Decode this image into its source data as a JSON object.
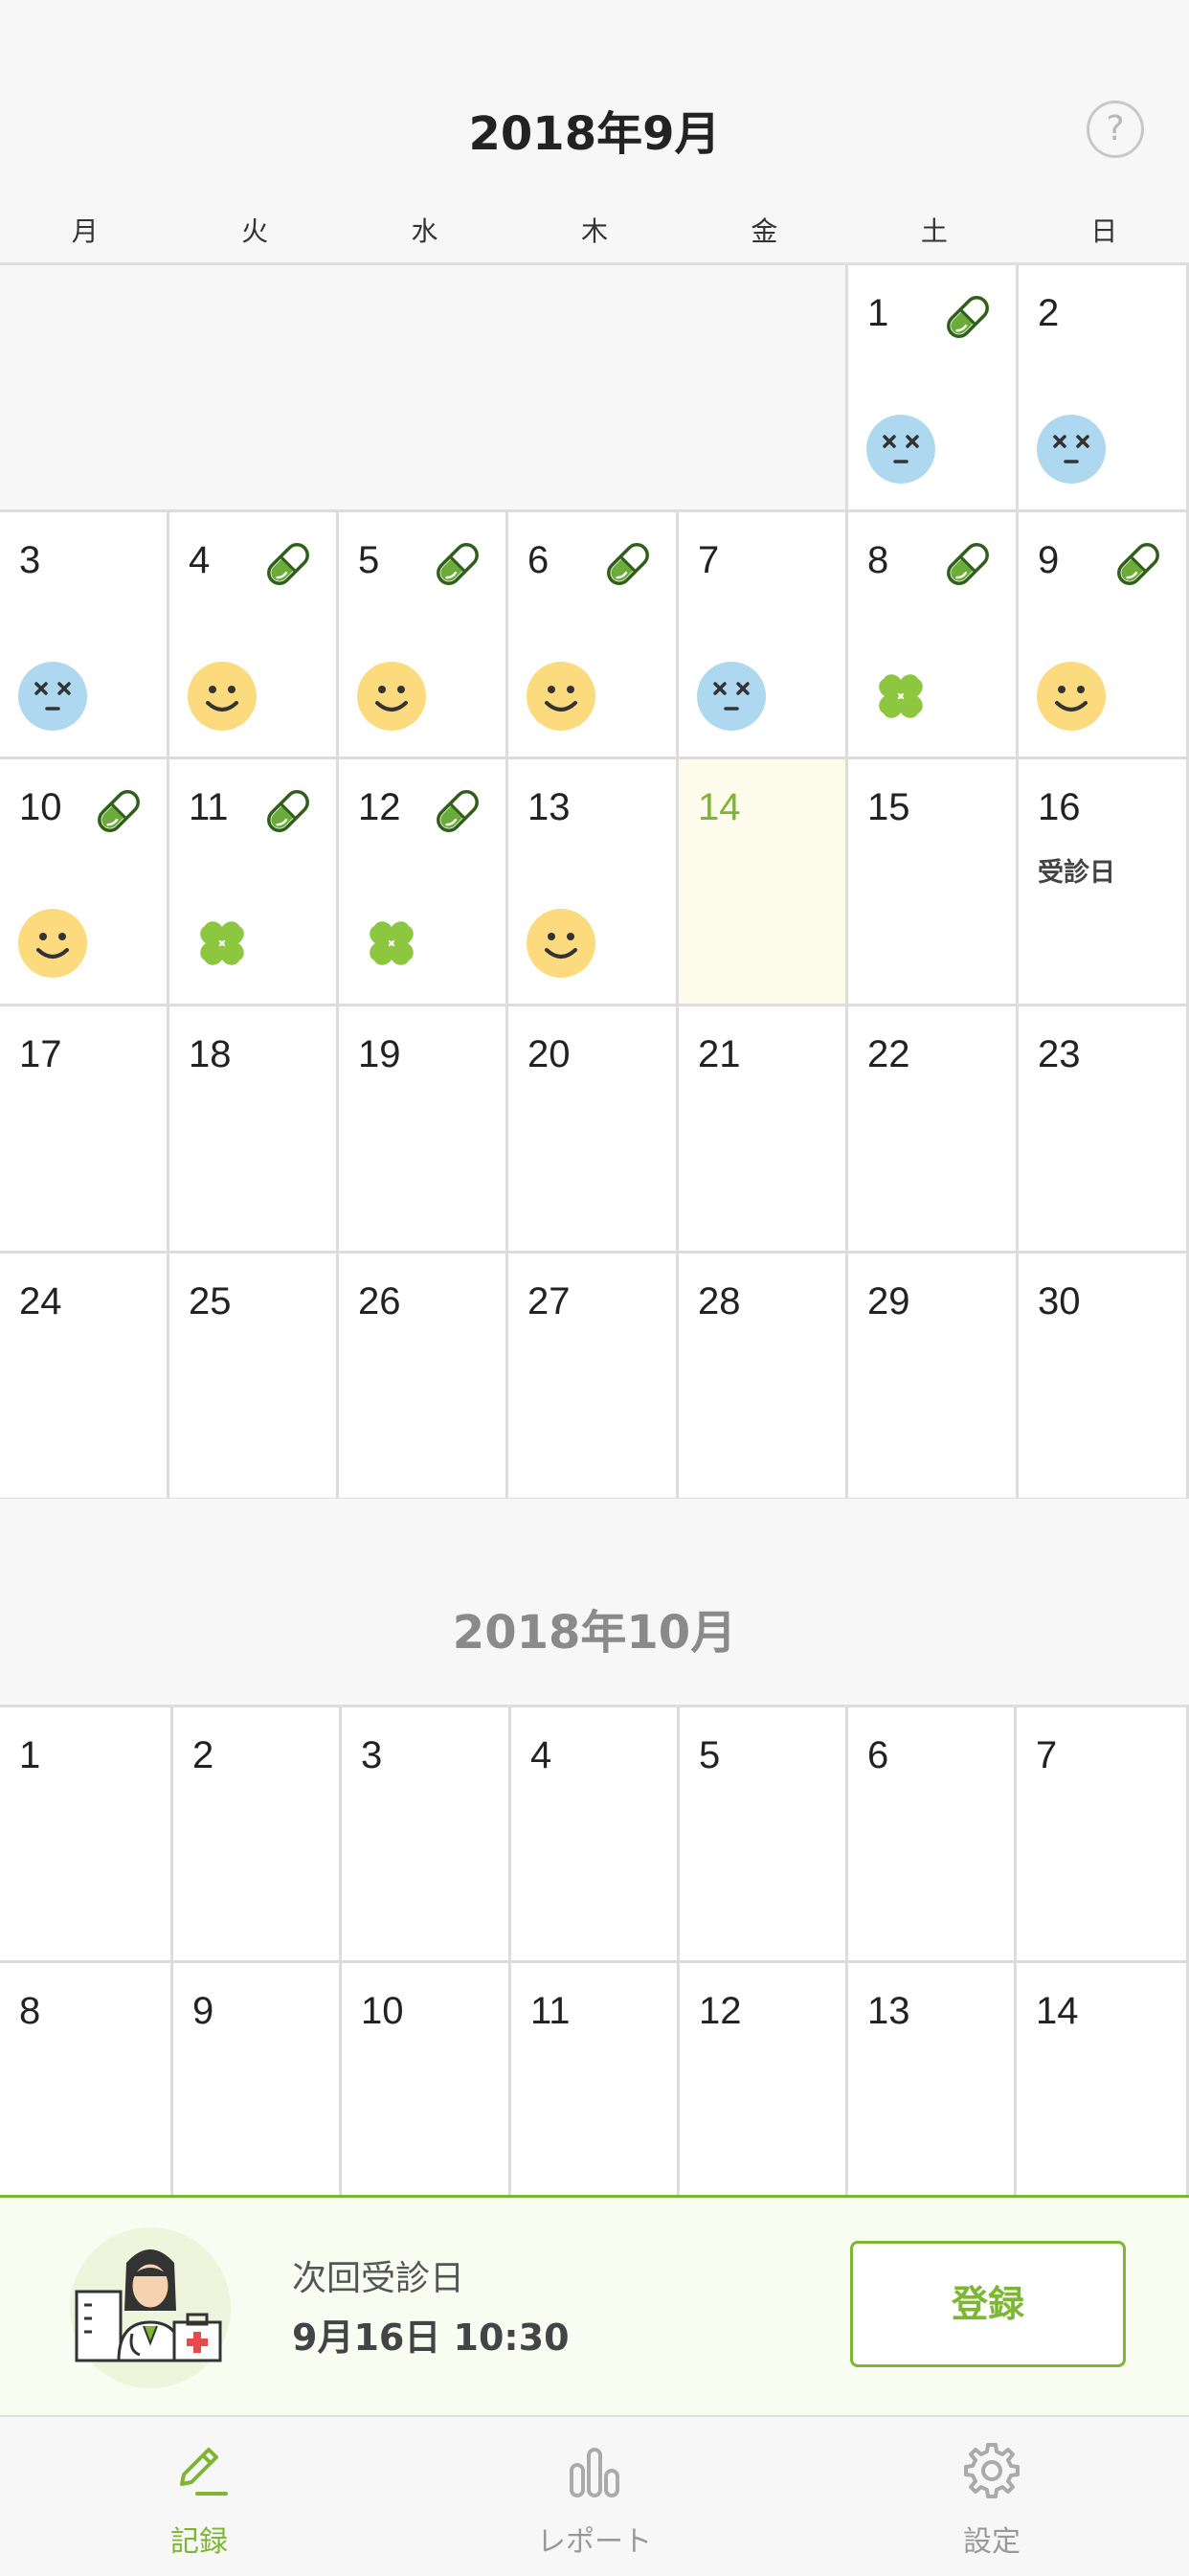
{
  "header": {
    "title": "2018年9月",
    "help_label": "?"
  },
  "weekdays": [
    "月",
    "火",
    "水",
    "木",
    "金",
    "土",
    "日"
  ],
  "september": {
    "weeks": [
      [
        null,
        null,
        null,
        null,
        null,
        {
          "day": "1",
          "pill": true,
          "mood": "dizzy"
        },
        {
          "day": "2",
          "pill": false,
          "mood": "dizzy"
        }
      ],
      [
        {
          "day": "3",
          "pill": false,
          "mood": "dizzy"
        },
        {
          "day": "4",
          "pill": true,
          "mood": "smile"
        },
        {
          "day": "5",
          "pill": true,
          "mood": "smile"
        },
        {
          "day": "6",
          "pill": true,
          "mood": "smile"
        },
        {
          "day": "7",
          "pill": false,
          "mood": "dizzy"
        },
        {
          "day": "8",
          "pill": true,
          "mood": "clover"
        },
        {
          "day": "9",
          "pill": true,
          "mood": "smile"
        }
      ],
      [
        {
          "day": "10",
          "pill": true,
          "mood": "smile"
        },
        {
          "day": "11",
          "pill": true,
          "mood": "clover"
        },
        {
          "day": "12",
          "pill": true,
          "mood": "clover"
        },
        {
          "day": "13",
          "pill": false,
          "mood": "smile"
        },
        {
          "day": "14",
          "today": true
        },
        {
          "day": "15"
        },
        {
          "day": "16",
          "note": "受診日"
        }
      ],
      [
        {
          "day": "17"
        },
        {
          "day": "18"
        },
        {
          "day": "19"
        },
        {
          "day": "20"
        },
        {
          "day": "21"
        },
        {
          "day": "22"
        },
        {
          "day": "23"
        }
      ],
      [
        {
          "day": "24"
        },
        {
          "day": "25"
        },
        {
          "day": "26"
        },
        {
          "day": "27"
        },
        {
          "day": "28"
        },
        {
          "day": "29"
        },
        {
          "day": "30"
        }
      ]
    ]
  },
  "october": {
    "title": "2018年10月",
    "weeks": [
      [
        {
          "day": "1"
        },
        {
          "day": "2"
        },
        {
          "day": "3"
        },
        {
          "day": "4"
        },
        {
          "day": "5"
        },
        {
          "day": "6"
        },
        {
          "day": "7"
        }
      ],
      [
        {
          "day": "8"
        },
        {
          "day": "9"
        },
        {
          "day": "10"
        },
        {
          "day": "11"
        },
        {
          "day": "12"
        },
        {
          "day": "13"
        },
        {
          "day": "14"
        }
      ]
    ]
  },
  "appointment": {
    "label": "次回受診日",
    "datetime": "9月16日 10:30",
    "register_label": "登録",
    "avatar_icon": "doctor-avatar-icon"
  },
  "tabs": [
    {
      "label": "記録",
      "icon": "pencil-icon",
      "active": true
    },
    {
      "label": "レポート",
      "icon": "bar-chart-icon",
      "active": false
    },
    {
      "label": "設定",
      "icon": "gear-icon",
      "active": false
    }
  ],
  "colors": {
    "accent": "#7cb632",
    "today_bg": "#fcfbec",
    "dizzy_face": "#aed8f0",
    "smile_face": "#fbdb7d",
    "clover": "#8dc63f",
    "pill_green": "#6aab3a"
  }
}
